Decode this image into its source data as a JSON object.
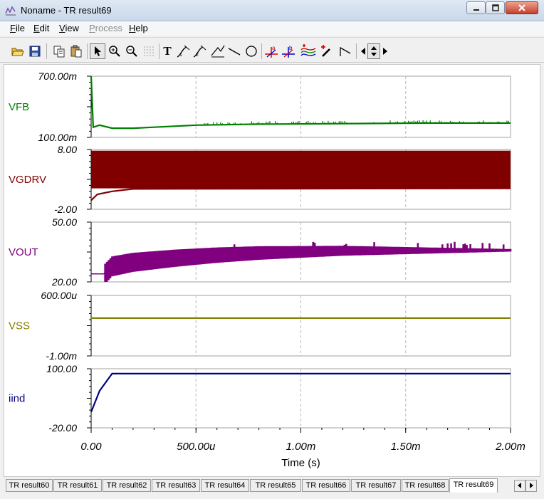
{
  "window": {
    "title": "Noname - TR result69"
  },
  "menu": [
    {
      "label": "File",
      "key": "F",
      "rest": "ile",
      "enabled": true
    },
    {
      "label": "Edit",
      "key": "E",
      "rest": "dit",
      "enabled": true
    },
    {
      "label": "View",
      "key": "V",
      "rest": "iew",
      "enabled": true
    },
    {
      "label": "Process",
      "key": "P",
      "rest": "rocess",
      "enabled": false
    },
    {
      "label": "Help",
      "key": "H",
      "rest": "elp",
      "enabled": true
    }
  ],
  "toolbar": {
    "icons": [
      "open-folder-icon",
      "save-icon",
      "copy-icon",
      "paste-icon",
      "pointer-icon",
      "zoom-in-icon",
      "zoom-out-icon",
      "grid-icon",
      "text-tool-icon",
      "cursor-a-icon",
      "cursor-b-icon",
      "slope-icon",
      "line-tool-icon",
      "ellipse-tool-icon",
      "marker-a-icon",
      "marker-b-icon",
      "curves-icon",
      "picker-icon",
      "angle-icon",
      "nav-left-icon",
      "nav-updown-icon",
      "nav-right-icon"
    ],
    "text_tool_glyph": "T",
    "marker_a": "a",
    "marker_b": "b"
  },
  "chart_data": {
    "type": "line",
    "xlabel": "Time (s)",
    "xlim": [
      0,
      0.002
    ],
    "x_ticks": [
      0,
      0.0005,
      0.001,
      0.0015,
      0.002
    ],
    "x_tick_labels": [
      "0.00",
      "500.00u",
      "1.00m",
      "1.50m",
      "2.00m"
    ],
    "grid": true,
    "panels": [
      {
        "name": "VFB",
        "color": "#008000",
        "ylim": [
          0.1,
          0.7
        ],
        "ytick_top": "700.00m",
        "ytick_bottom": "100.00m",
        "x": [
          0,
          1e-05,
          4e-05,
          0.0001,
          0.0002,
          0.0003,
          0.0005,
          0.0008,
          0.0012,
          0.0016,
          0.002
        ],
        "y": [
          0.7,
          0.2,
          0.22,
          0.19,
          0.19,
          0.2,
          0.22,
          0.23,
          0.235,
          0.24,
          0.24
        ]
      },
      {
        "name": "VGDRV",
        "color": "#800000",
        "ylim": [
          -2,
          8
        ],
        "ytick_top": "8.00",
        "ytick_bottom": "-2.00",
        "band": {
          "min": 1.5,
          "max": 7.8
        },
        "x": [
          0,
          3e-05,
          0.0001,
          0.0002,
          0.002
        ],
        "y": [
          -0.5,
          0.5,
          1.0,
          1.4,
          1.5
        ]
      },
      {
        "name": "VOUT",
        "color": "#800080",
        "ylim": [
          20,
          50
        ],
        "ytick_top": "50.00",
        "ytick_bottom": "20.00",
        "x": [
          0,
          6e-05,
          0.0001,
          0.0002,
          0.0004,
          0.0006,
          0.0008,
          0.001,
          0.0012,
          0.0014,
          0.0016,
          0.0018,
          0.002
        ],
        "y": [
          24,
          24,
          28.5,
          30.5,
          32.5,
          34,
          35,
          35.5,
          36,
          36,
          36,
          36,
          36
        ]
      },
      {
        "name": "VSS",
        "color": "#808000",
        "ylim": [
          -0.001,
          0.0006
        ],
        "ytick_top": "600.00u",
        "ytick_bottom": "-1.00m",
        "x": [
          0,
          0.002
        ],
        "y": [
          0,
          0
        ]
      },
      {
        "name": "iind",
        "color": "#000080",
        "ylim": [
          -20,
          100
        ],
        "ytick_top": "100.00",
        "ytick_bottom": "-20.00",
        "x": [
          0,
          4e-05,
          0.0001,
          0.00011,
          0.002
        ],
        "y": [
          12,
          55,
          90,
          90,
          90
        ]
      }
    ]
  },
  "tabs": [
    "TR result60",
    "TR result61",
    "TR result62",
    "TR result63",
    "TR result64",
    "TR result65",
    "TR result66",
    "TR result67",
    "TR result68",
    "TR result69"
  ],
  "active_tab": "TR result69"
}
